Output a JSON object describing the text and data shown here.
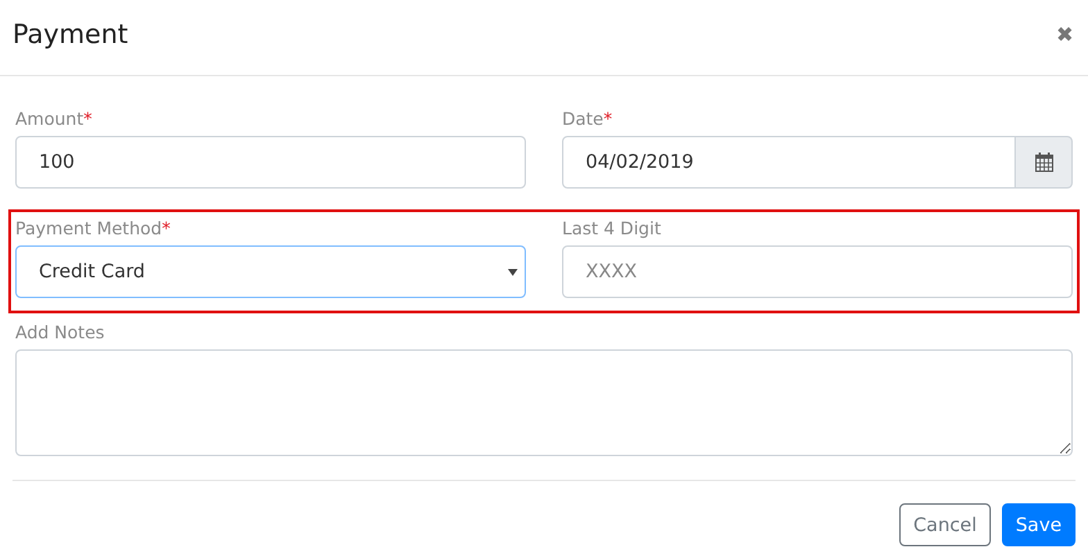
{
  "dialog": {
    "title": "Payment",
    "close": "✖"
  },
  "rows": [
    {
      "highlighted": false,
      "fields": [
        {
          "kind": "text",
          "label": "Amount",
          "marker": "*",
          "value": "100",
          "focused": false
        },
        {
          "kind": "date",
          "label": "Date",
          "marker": "*",
          "value": "04/02/2019",
          "focused": false
        }
      ]
    },
    {
      "highlighted": true,
      "fields": [
        {
          "kind": "select",
          "label": "Payment Method",
          "marker": "*",
          "value": "Credit Card",
          "focused": true
        },
        {
          "kind": "text",
          "label": "Last 4 Digit",
          "placeholder": "XXXX",
          "focused": false
        }
      ]
    },
    {
      "highlighted": false,
      "fields": [
        {
          "kind": "textarea",
          "label": "Add Notes",
          "focused": false
        }
      ]
    }
  ],
  "buttons": [
    {
      "kind": "secondary",
      "label": "Cancel"
    },
    {
      "kind": "primary",
      "label": "Save"
    }
  ]
}
